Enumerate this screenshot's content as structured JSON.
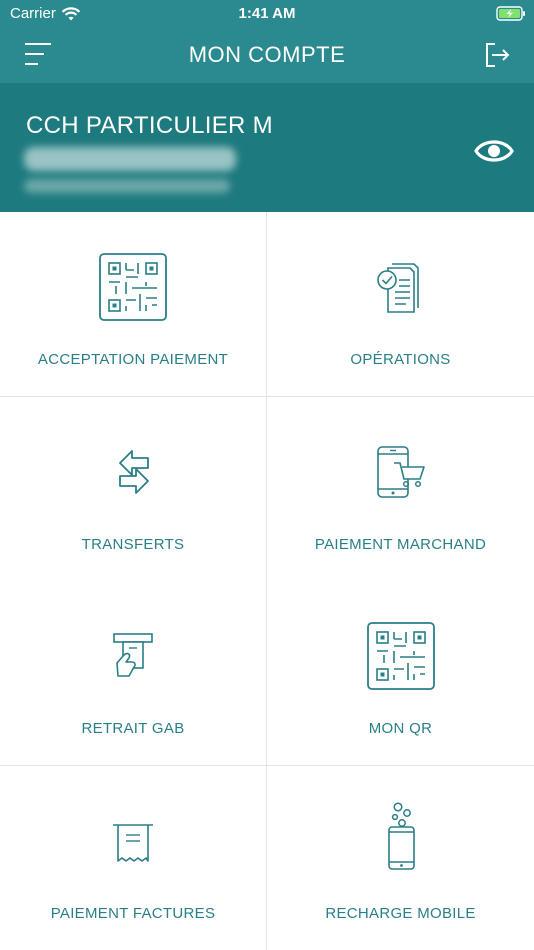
{
  "status_bar": {
    "carrier": "Carrier",
    "time": "1:41 AM"
  },
  "nav": {
    "title": "MON COMPTE"
  },
  "account": {
    "name": "CCH PARTICULIER M"
  },
  "colors": {
    "header": "#2a8a8f",
    "account_band": "#1d7a7e",
    "accent": "#2a7f87"
  },
  "tiles": [
    {
      "label": "ACCEPTATION PAIEMENT",
      "icon": "qr-code-icon"
    },
    {
      "label": "OPÉRATIONS",
      "icon": "document-check-icon"
    },
    {
      "label": "TRANSFERTS",
      "icon": "transfer-arrows-icon"
    },
    {
      "label": "PAIEMENT MARCHAND",
      "icon": "phone-cart-icon"
    },
    {
      "label": "RETRAIT GAB",
      "icon": "atm-withdraw-icon"
    },
    {
      "label": "MON QR",
      "icon": "qr-code-icon"
    },
    {
      "label": "PAIEMENT FACTURES",
      "icon": "bill-receipt-icon"
    },
    {
      "label": "RECHARGE MOBILE",
      "icon": "mobile-recharge-icon"
    }
  ]
}
